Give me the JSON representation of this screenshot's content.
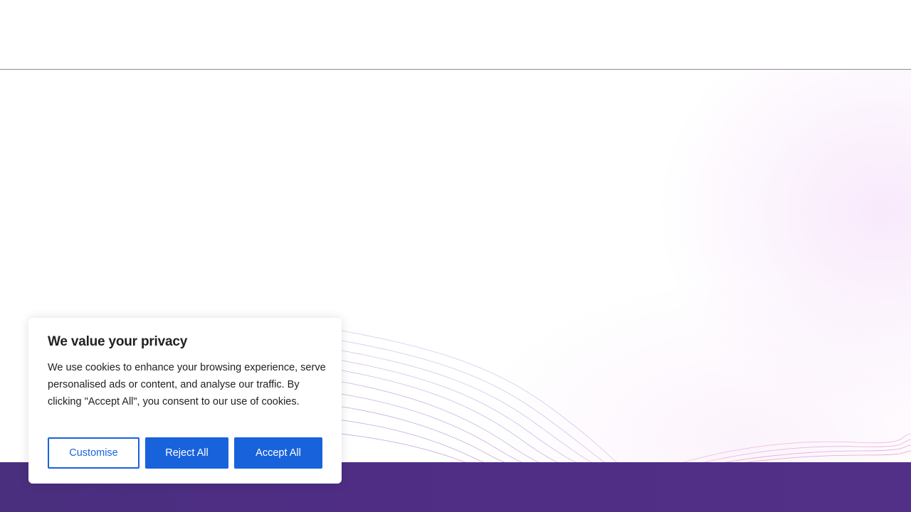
{
  "cookie_banner": {
    "title": "We value your privacy",
    "message": "We use cookies to enhance your browsing experience, serve personalised ads or content, and analyse our traffic. By clicking \"Accept All\", you consent to our use of cookies.",
    "buttons": {
      "customise": "Customise",
      "reject": "Reject All",
      "accept": "Accept All"
    }
  },
  "colors": {
    "button_primary": "#1863dc",
    "footer_band": "#4f2d85",
    "wave_lines": "#c9b6e6"
  }
}
